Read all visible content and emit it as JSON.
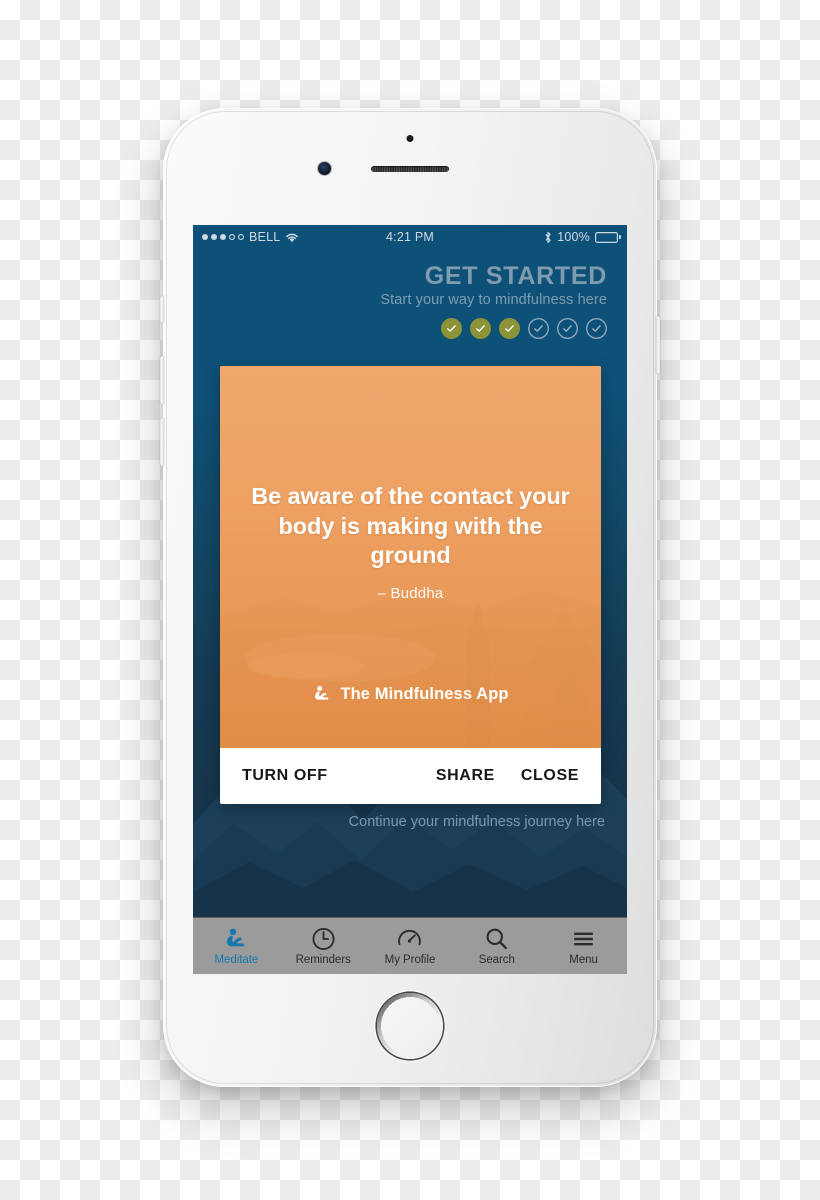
{
  "device": {
    "name": "white-smartphone-mockup",
    "hardware": {
      "front_camera": "front-camera",
      "earpiece": "earpiece-speaker",
      "sensor": "proximity-sensor",
      "home_button": "home-button",
      "silent_switch": "silent-switch",
      "volume_up": "volume-up-button",
      "volume_down": "volume-down-button",
      "power": "power-button"
    }
  },
  "status_bar": {
    "carrier": "BELL",
    "signal_dots_total": 5,
    "signal_dots_filled": 3,
    "wifi_icon": "wifi-icon",
    "time": "4:21 PM",
    "bluetooth_icon": "bluetooth-icon",
    "battery_percent": "100%",
    "battery_level": 100
  },
  "header": {
    "title": "GET STARTED",
    "subtitle": "Start your way to mindfulness here",
    "steps": [
      {
        "state": "done"
      },
      {
        "state": "done"
      },
      {
        "state": "done"
      },
      {
        "state": "todo"
      },
      {
        "state": "todo"
      },
      {
        "state": "todo"
      }
    ],
    "steps_completed": 3,
    "steps_total": 6
  },
  "quote_card": {
    "quote": "Be aware of the contact your body is making with the ground",
    "author": "– Buddha",
    "brand_icon": "meditating-person-icon",
    "brand_name": "The Mindfulness App",
    "actions": {
      "turn_off": "TURN OFF",
      "share": "SHARE",
      "close": "CLOSE"
    }
  },
  "continue_text": "Continue your mindfulness journey here",
  "tab_bar": {
    "items": [
      {
        "label": "Meditate",
        "icon": "meditating-person-icon",
        "active": true
      },
      {
        "label": "Reminders",
        "icon": "clock-icon",
        "active": false
      },
      {
        "label": "My Profile",
        "icon": "gauge-icon",
        "active": false
      },
      {
        "label": "Search",
        "icon": "magnifier-icon",
        "active": false
      },
      {
        "label": "Menu",
        "icon": "hamburger-menu-icon",
        "active": false
      }
    ]
  },
  "colors": {
    "header_blue": "#0e5178",
    "deep_blue": "#16344a",
    "card_orange": "#eb9e5f",
    "step_done": "#8d9338",
    "accent_blue": "#1579ab",
    "tab_bar_gray": "#9b9b9b",
    "muted_text": "#7f9baf"
  }
}
